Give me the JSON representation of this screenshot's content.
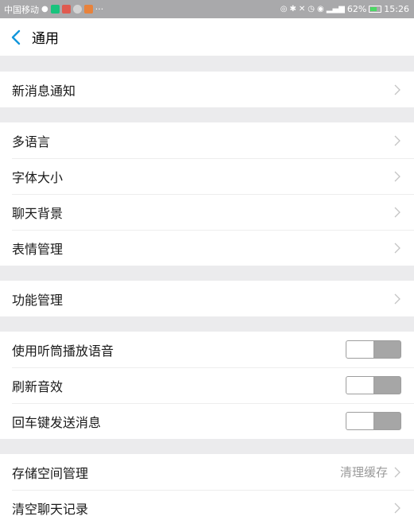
{
  "statusbar": {
    "carrier": "中国移动",
    "more": "···",
    "battery": "62%",
    "time": "15:26"
  },
  "header": {
    "title": "通用",
    "back_icon": "chevron-left-icon"
  },
  "groups": {
    "g1": {
      "items": [
        {
          "label": "新消息通知",
          "type": "link"
        }
      ]
    },
    "g2": {
      "items": [
        {
          "label": "多语言",
          "type": "link"
        },
        {
          "label": "字体大小",
          "type": "link"
        },
        {
          "label": "聊天背景",
          "type": "link"
        },
        {
          "label": "表情管理",
          "type": "link"
        }
      ]
    },
    "g3": {
      "items": [
        {
          "label": "功能管理",
          "type": "link"
        }
      ]
    },
    "g4": {
      "items": [
        {
          "label": "使用听筒播放语音",
          "type": "toggle",
          "on": false
        },
        {
          "label": "刷新音效",
          "type": "toggle",
          "on": false
        },
        {
          "label": "回车键发送消息",
          "type": "toggle",
          "on": false
        }
      ]
    },
    "g5": {
      "items": [
        {
          "label": "存储空间管理",
          "type": "link",
          "detail": "清理缓存"
        },
        {
          "label": "清空聊天记录",
          "type": "link"
        }
      ]
    }
  },
  "colors": {
    "accent": "#1296db",
    "background": "#ebebed",
    "statusbar": "#a9a9ab",
    "toggle_off": "#a6a6a6"
  }
}
